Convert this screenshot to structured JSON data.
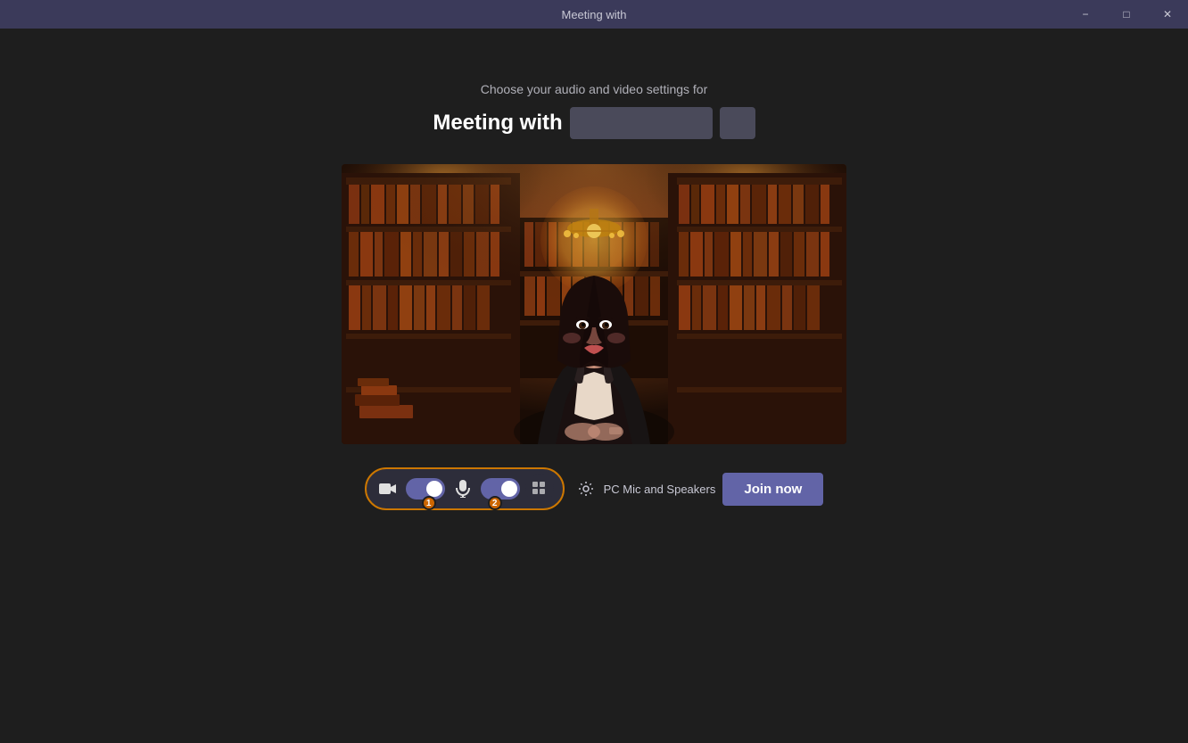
{
  "titlebar": {
    "title": "Meeting with",
    "minimize_label": "−",
    "maximize_label": "□",
    "close_label": "✕"
  },
  "main": {
    "subtitle": "Choose your audio and video settings for",
    "meeting_title": "Meeting with",
    "join_button_label": "Join now",
    "audio_device_label": "PC Mic and Speakers"
  },
  "controls": {
    "camera_toggle_state": "on",
    "mic_toggle_state": "on",
    "badge_camera": "1",
    "badge_effects": "2"
  }
}
